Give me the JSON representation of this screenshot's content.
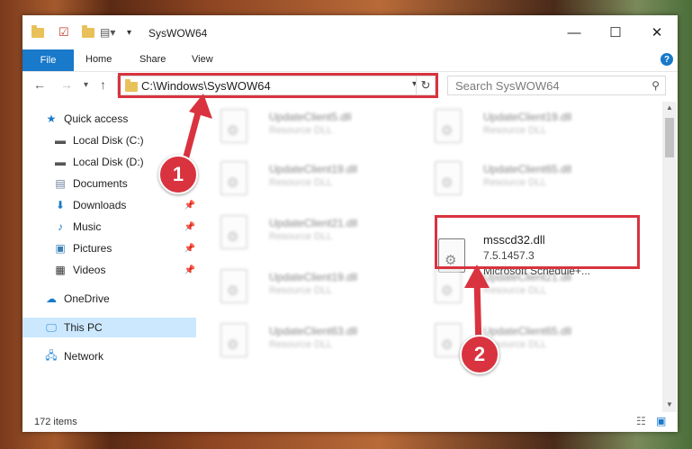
{
  "window": {
    "title": "SysWOW64"
  },
  "ribbon": {
    "file": "File",
    "home": "Home",
    "share": "Share",
    "view": "View",
    "help": "?"
  },
  "nav": {
    "address": "C:\\Windows\\SysWOW64",
    "search_placeholder": "Search SysWOW64"
  },
  "sidebar": {
    "items": [
      {
        "label": "Quick access",
        "icon": "star-icon"
      },
      {
        "label": "Local Disk (C:)",
        "icon": "drive-icon"
      },
      {
        "label": "Local Disk (D:)",
        "icon": "drive-icon"
      },
      {
        "label": "Documents",
        "icon": "document-icon"
      },
      {
        "label": "Downloads",
        "icon": "download-icon"
      },
      {
        "label": "Music",
        "icon": "music-icon"
      },
      {
        "label": "Pictures",
        "icon": "picture-icon"
      },
      {
        "label": "Videos",
        "icon": "video-icon"
      },
      {
        "label": "OneDrive",
        "icon": "cloud-icon"
      },
      {
        "label": "This PC",
        "icon": "computer-icon"
      },
      {
        "label": "Network",
        "icon": "network-icon"
      }
    ]
  },
  "files": [
    {
      "name": "UpdateClient5.dll",
      "desc": "Resource DLL"
    },
    {
      "name": "UpdateClient19.dll",
      "desc": "Resource DLL"
    },
    {
      "name": "UpdateClient19.dll",
      "desc": "Resource DLL"
    },
    {
      "name": "UpdateClient65.dll",
      "desc": "Resource DLL"
    },
    {
      "name": "UpdateClient21.dll",
      "desc": "Resource DLL"
    },
    {
      "name": "msscd32.dll",
      "desc": "7.5.1457.3",
      "desc2": "Microsoft Schedule+..."
    },
    {
      "name": "UpdateClient19.dll",
      "desc": "Resource DLL"
    },
    {
      "name": "UpdateClient21.dll",
      "desc": "Resource DLL"
    },
    {
      "name": "UpdateClient63.dll",
      "desc": "Resource DLL"
    },
    {
      "name": "UpdateClient65.dll",
      "desc": "Resource DLL"
    }
  ],
  "status": {
    "count": "172 items"
  },
  "annotations": {
    "step1": "1",
    "step2": "2"
  },
  "colors": {
    "accent": "#1979ca",
    "highlight_red": "#d9333f",
    "selected": "#cce8ff"
  }
}
